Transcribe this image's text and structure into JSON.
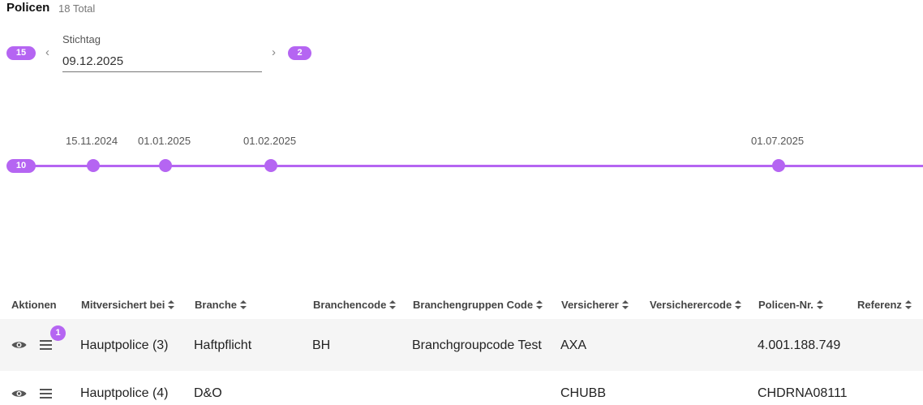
{
  "header": {
    "title": "Policen",
    "total": "18 Total"
  },
  "stichtag": {
    "label": "Stichtag",
    "value": "09.12.2025",
    "prev_count": "15",
    "next_count": "2"
  },
  "timeline": {
    "start_count": "10",
    "dates": [
      "15.11.2024",
      "01.01.2025",
      "01.02.2025",
      "01.07.2025"
    ]
  },
  "table": {
    "columns": [
      "Aktionen",
      "Mitversichert bei",
      "Branche",
      "Branchencode",
      "Branchengruppen Code",
      "Versicherer",
      "Versicherercode",
      "Policen-Nr.",
      "Referenz"
    ],
    "rows": [
      {
        "badge": "1",
        "mitversichert": "Hauptpolice (3)",
        "branche": "Haftpflicht",
        "branchencode": "BH",
        "gruppencode": "Branchgroupcode Test",
        "versicherer": "AXA",
        "versicherercode": "",
        "policen_nr": "4.001.188.749",
        "referenz": ""
      },
      {
        "badge": "",
        "mitversichert": "Hauptpolice (4)",
        "branche": "D&O",
        "branchencode": "",
        "gruppencode": "",
        "versicherer": "CHUBB",
        "versicherercode": "",
        "policen_nr": "CHDRNA08111",
        "referenz": ""
      }
    ]
  },
  "icons": {
    "view": "eye-icon",
    "menu": "hamburger-menu-icon",
    "sort": "sort-arrows-icon",
    "prev": "chevron-left-icon",
    "next": "chevron-right-icon"
  },
  "colors": {
    "accent": "#b565f2",
    "row_highlight": "#f5f5f5"
  }
}
